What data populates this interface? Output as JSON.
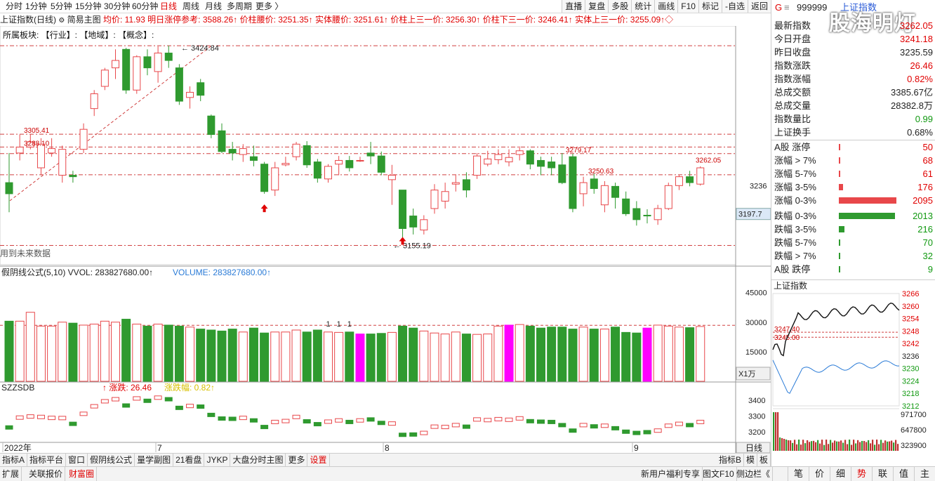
{
  "tabs": [
    "分时",
    "1分钟",
    "5分钟",
    "15分钟",
    "30分钟",
    "60分钟",
    "日线",
    "周线",
    "月线",
    "多周期",
    "更多 〉"
  ],
  "active_tab": "日线",
  "right_buttons": [
    "直播",
    "复盘",
    "多股",
    "统计",
    "画线",
    "F10",
    "标记",
    "-自选",
    "返回"
  ],
  "info": {
    "name": "上证指数(日线)",
    "mode": "简易主图",
    "avg": "均价: 11.93",
    "limit_ref": "明日涨停参考: 3588.26",
    "waist": "价柱腰价: 3251.35",
    "body_waist": "实体腰价: 3251.61",
    "up13": "价柱上三一价: 3256.30",
    "down13": "价柱下三一价: 3246.41",
    "body_up13": "实体上三一价: 3255.09"
  },
  "sector_line": "所属板块:    【行业】:          【地域】:          【概念】:",
  "future_note": "用到未来数据",
  "vol_indicator": {
    "name": "假阴线公式(5,10)",
    "vvol": "VVOL: 283827680.00",
    "volume": "VOLUME: 283827680.00"
  },
  "szz": {
    "name": "SZZSDB",
    "change": "涨跌: 26.46",
    "pct": "涨跌幅: 0.82"
  },
  "x_labels": {
    "year": "2022年",
    "m7": "7",
    "m8": "8",
    "m9": "9"
  },
  "vol_unit": "X1万",
  "period_label": "日线",
  "chart_data": {
    "type": "candlestick",
    "price_levels": {
      "high_mark": "3424.84",
      "low_mark": "3155.19",
      "l1": "3305.41",
      "l2": "3288.10",
      "l3": "3279.17",
      "l4": "3262.05",
      "l5": "3250.63",
      "axis_3236": "3236",
      "cursor": "3197.7"
    },
    "vol_axis": [
      "45000",
      "30000",
      "15000"
    ],
    "szz_axis": [
      "3400",
      "3300",
      "3200"
    ],
    "candles": [
      [
        3240,
        3280,
        3200,
        3225
      ],
      [
        3280,
        3305,
        3270,
        3288
      ],
      [
        3288,
        3305,
        3285,
        3295
      ],
      [
        3260,
        3300,
        3250,
        3292
      ],
      [
        3280,
        3300,
        3275,
        3286
      ],
      [
        3250,
        3290,
        3240,
        3285
      ],
      [
        3250,
        3256,
        3240,
        3248
      ],
      [
        3285,
        3320,
        3280,
        3312
      ],
      [
        3340,
        3365,
        3330,
        3360
      ],
      [
        3370,
        3395,
        3365,
        3392
      ],
      [
        3395,
        3420,
        3380,
        3405
      ],
      [
        3420,
        3422,
        3360,
        3365
      ],
      [
        3365,
        3412,
        3360,
        3410
      ],
      [
        3410,
        3420,
        3385,
        3395
      ],
      [
        3390,
        3424,
        3375,
        3415
      ],
      [
        3415,
        3425,
        3395,
        3405
      ],
      [
        3395,
        3400,
        3345,
        3350
      ],
      [
        3355,
        3370,
        3340,
        3362
      ],
      [
        3375,
        3380,
        3350,
        3358
      ],
      [
        3330,
        3332,
        3300,
        3305
      ],
      [
        3310,
        3320,
        3280,
        3282
      ],
      [
        3285,
        3295,
        3270,
        3280
      ],
      [
        3278,
        3292,
        3268,
        3286
      ],
      [
        3275,
        3290,
        3262,
        3270
      ],
      [
        3265,
        3268,
        3225,
        3228
      ],
      [
        3230,
        3268,
        3222,
        3260
      ],
      [
        3264,
        3275,
        3262,
        3266
      ],
      [
        3275,
        3295,
        3270,
        3292
      ],
      [
        3290,
        3296,
        3260,
        3264
      ],
      [
        3268,
        3272,
        3240,
        3246
      ],
      [
        3245,
        3265,
        3240,
        3262
      ],
      [
        3265,
        3276,
        3250,
        3270
      ],
      [
        3270,
        3276,
        3255,
        3260
      ],
      [
        3270,
        3275,
        3268,
        3270
      ],
      [
        3280,
        3295,
        3265,
        3276
      ],
      [
        3276,
        3282,
        3250,
        3254
      ],
      [
        3244,
        3264,
        3210,
        3250
      ],
      [
        3230,
        3230,
        3160,
        3178
      ],
      [
        3195,
        3205,
        3170,
        3180
      ],
      [
        3176,
        3196,
        3170,
        3190
      ],
      [
        3205,
        3238,
        3198,
        3230
      ],
      [
        3215,
        3240,
        3205,
        3228
      ],
      [
        3238,
        3250,
        3228,
        3240
      ],
      [
        3244,
        3254,
        3220,
        3230
      ],
      [
        3250,
        3280,
        3245,
        3276
      ],
      [
        3265,
        3283,
        3262,
        3272
      ],
      [
        3271,
        3285,
        3265,
        3278
      ],
      [
        3268,
        3285,
        3262,
        3274
      ],
      [
        3278,
        3289,
        3270,
        3283
      ],
      [
        3283,
        3285,
        3258,
        3265
      ],
      [
        3270,
        3275,
        3250,
        3262
      ],
      [
        3268,
        3275,
        3250,
        3260
      ],
      [
        3264,
        3280,
        3238,
        3240
      ],
      [
        3275,
        3279,
        3200,
        3205
      ],
      [
        3225,
        3248,
        3208,
        3240
      ],
      [
        3245,
        3252,
        3225,
        3232
      ],
      [
        3210,
        3242,
        3200,
        3236
      ],
      [
        3235,
        3240,
        3205,
        3220
      ],
      [
        3218,
        3228,
        3195,
        3198
      ],
      [
        3205,
        3215,
        3182,
        3190
      ],
      [
        3196,
        3204,
        3185,
        3195
      ],
      [
        3190,
        3210,
        3183,
        3205
      ],
      [
        3205,
        3240,
        3203,
        3236
      ],
      [
        3236,
        3250,
        3230,
        3248
      ],
      [
        3248,
        3256,
        3235,
        3240
      ],
      [
        3238,
        3262,
        3236,
        3260
      ]
    ],
    "volumes": [
      30.5,
      30.5,
      35,
      28,
      28,
      30,
      29.5,
      28.5,
      29,
      30.5,
      30,
      31.5,
      29,
      28,
      29,
      28.5,
      28,
      27.5,
      26.5,
      26,
      25.5,
      26.5,
      25,
      27,
      24.5,
      25,
      25,
      26,
      25,
      26,
      25,
      24.8,
      25,
      24,
      24,
      24.3,
      24.8,
      28,
      27,
      25.5,
      24.5,
      24,
      25,
      24,
      23.8,
      24,
      28,
      28.5,
      28.8,
      28,
      27,
      27.5,
      27.5,
      26.5,
      27.5,
      26.5,
      26.5,
      27.5,
      24.8,
      24.5,
      27,
      28.5,
      28,
      27.5,
      27.2,
      27.8
    ],
    "szz": [
      3225,
      3288,
      3295,
      3292,
      3286,
      3285,
      3248,
      3312,
      3360,
      3392,
      3405,
      3365,
      3410,
      3395,
      3415,
      3405,
      3350,
      3362,
      3358,
      3305,
      3282,
      3280,
      3286,
      3270,
      3228,
      3260,
      3266,
      3292,
      3264,
      3246,
      3262,
      3270,
      3260,
      3270,
      3276,
      3254,
      3250,
      3178,
      3180,
      3190,
      3230,
      3228,
      3240,
      3230,
      3276,
      3272,
      3278,
      3274,
      3283,
      3265,
      3262,
      3260,
      3240,
      3205,
      3240,
      3232,
      3236,
      3220,
      3198,
      3190,
      3195,
      3205,
      3236,
      3248,
      3240,
      3260
    ]
  },
  "right_panel": {
    "code": "999999",
    "name": "上证指数",
    "stats": [
      {
        "label": "最新指数",
        "value": "3262.05",
        "color": "#e00000"
      },
      {
        "label": "今日开盘",
        "value": "3241.18",
        "color": "#e00000"
      },
      {
        "label": "昨日收盘",
        "value": "3235.59",
        "color": "#222222"
      },
      {
        "label": "指数涨跌",
        "value": "26.46",
        "color": "#e00000"
      },
      {
        "label": "指数涨幅",
        "value": "0.82%",
        "color": "#e00000"
      },
      {
        "label": "总成交额",
        "value": "3385.67亿",
        "color": "#222222"
      },
      {
        "label": "总成交量",
        "value": "28382.8万",
        "color": "#222222"
      },
      {
        "label": "指数量比",
        "value": "0.99",
        "color": "#119911"
      },
      {
        "label": "上证换手",
        "value": "0.68%",
        "color": "#222222"
      }
    ],
    "breadth": [
      {
        "label": "A股 涨停",
        "value": "50",
        "pct": 0.5,
        "color": "#e8474a"
      },
      {
        "label": "涨幅 > 7%",
        "value": "68",
        "pct": 1,
        "color": "#e8474a"
      },
      {
        "label": "涨幅 5-7%",
        "value": "61",
        "pct": 1,
        "color": "#e8474a"
      },
      {
        "label": "涨幅 3-5%",
        "value": "176",
        "pct": 3,
        "color": "#e8474a"
      },
      {
        "label": "涨幅 0-3%",
        "value": "2095",
        "pct": 43,
        "color": "#e8474a"
      },
      {
        "label": "跌幅 0-3%",
        "value": "2013",
        "pct": 42,
        "color": "#2f9a2f"
      },
      {
        "label": "跌幅 3-5%",
        "value": "216",
        "pct": 4,
        "color": "#2f9a2f"
      },
      {
        "label": "跌幅 5-7%",
        "value": "70",
        "pct": 1,
        "color": "#2f9a2f"
      },
      {
        "label": "跌幅 > 7%",
        "value": "32",
        "pct": 0.5,
        "color": "#2f9a2f"
      },
      {
        "label": "A股 跌停",
        "value": "9",
        "pct": 0.3,
        "color": "#2f9a2f"
      }
    ],
    "mini_title": "上证指数",
    "mini_axis": [
      "3266",
      "3260",
      "3254",
      "3248",
      "3242",
      "3236",
      "3230",
      "3224",
      "3218",
      "3212"
    ],
    "mini_marks": {
      "a": "3247.40",
      "b": "3245.00"
    },
    "mini_vol_axis": [
      "971700",
      "647800",
      "323900"
    ]
  },
  "bottom_tabs": [
    "指标A",
    "指标平台",
    "窗口",
    "假阴线公式",
    "量学副图",
    "21看盘",
    "JYKP",
    "大盘分时主图",
    "更多",
    "设置"
  ],
  "bottom_tabs2_left": [
    "扩展",
    "关联报价",
    "财富圈"
  ],
  "bottom_right_small": [
    "指标B",
    "模",
    "板"
  ],
  "bottom_news": "新用户福利专享",
  "bottom_f10": "图文F10",
  "bottom_side": "侧边栏《",
  "right_tabs": [
    "笔",
    "价",
    "细",
    "势",
    "联",
    "值",
    "主"
  ],
  "active_right_tab": "势",
  "watermark": "股海明灯"
}
